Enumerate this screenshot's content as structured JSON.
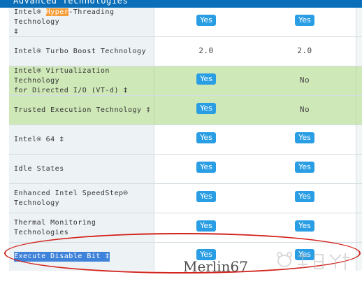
{
  "header": {
    "title": "Advanced Technologies"
  },
  "rows": [
    {
      "label_pre": "Intel® ",
      "label_hl": "Hyper",
      "label_post": "-Threading Technology\n‡",
      "col1": "Yes",
      "col2": "Yes",
      "col1_badge": true,
      "col2_badge": true,
      "green": false
    },
    {
      "label": "Intel® Turbo Boost Technology",
      "col1": "2.0",
      "col2": "2.0",
      "col1_badge": false,
      "col2_badge": false,
      "green": false
    },
    {
      "label": "Intel® Virtualization Technology\nfor Directed I/O (VT-d) ‡",
      "col1": "Yes",
      "col2": "No",
      "col1_badge": true,
      "col2_badge": false,
      "green": true
    },
    {
      "label": "Trusted Execution Technology ‡",
      "col1": "Yes",
      "col2": "No",
      "col1_badge": true,
      "col2_badge": false,
      "green": true
    },
    {
      "label": "Intel® 64 ‡",
      "col1": "Yes",
      "col2": "Yes",
      "col1_badge": true,
      "col2_badge": true,
      "green": false
    },
    {
      "label": "Idle States",
      "col1": "Yes",
      "col2": "Yes",
      "col1_badge": true,
      "col2_badge": true,
      "green": false
    },
    {
      "label": "Enhanced Intel SpeedStep®\nTechnology",
      "col1": "Yes",
      "col2": "Yes",
      "col1_badge": true,
      "col2_badge": true,
      "green": false
    },
    {
      "label": "Thermal Monitoring Technologies",
      "col1": "Yes",
      "col2": "Yes",
      "col1_badge": true,
      "col2_badge": true,
      "green": false
    },
    {
      "label": "Execute Disable Bit ‡",
      "col1": "Yes",
      "col2": "Yes",
      "col1_badge": true,
      "col2_badge": true,
      "green": false,
      "selected": true
    }
  ],
  "watermark": {
    "text": "Merlin67"
  },
  "colors": {
    "header_bg": "#0a6fb8",
    "badge_bg": "#2a9ee4",
    "green_row": "#cfe8b8",
    "highlight": "#f59e3a",
    "annotation_oval": "#d3231d"
  },
  "icons": {
    "baidu_logo": "baidu-jingyan-logo"
  }
}
